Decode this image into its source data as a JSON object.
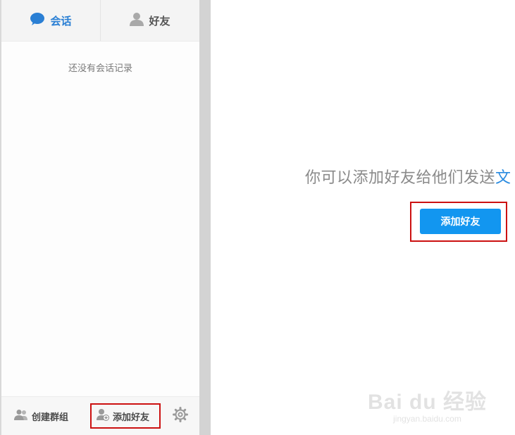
{
  "tabs": [
    {
      "label": "会话",
      "icon": "chat-bubble-icon",
      "active": true
    },
    {
      "label": "好友",
      "icon": "user-icon",
      "active": false
    }
  ],
  "sidebar": {
    "empty_text": "还没有会话记录"
  },
  "bottom_bar": {
    "create_group": "创建群组",
    "add_friend": "添加好友",
    "settings_icon": "gear-icon"
  },
  "main": {
    "hint_text": "你可以添加好友给他们发送",
    "hint_highlight": "文",
    "add_friend_button": "添加好友"
  },
  "watermark": {
    "logo": "Bai du 经验",
    "url": "jingyan.baidu.com"
  },
  "colors": {
    "accent_blue": "#2a7fd4",
    "button_blue": "#1296f0",
    "highlight_red": "#cc1111"
  }
}
